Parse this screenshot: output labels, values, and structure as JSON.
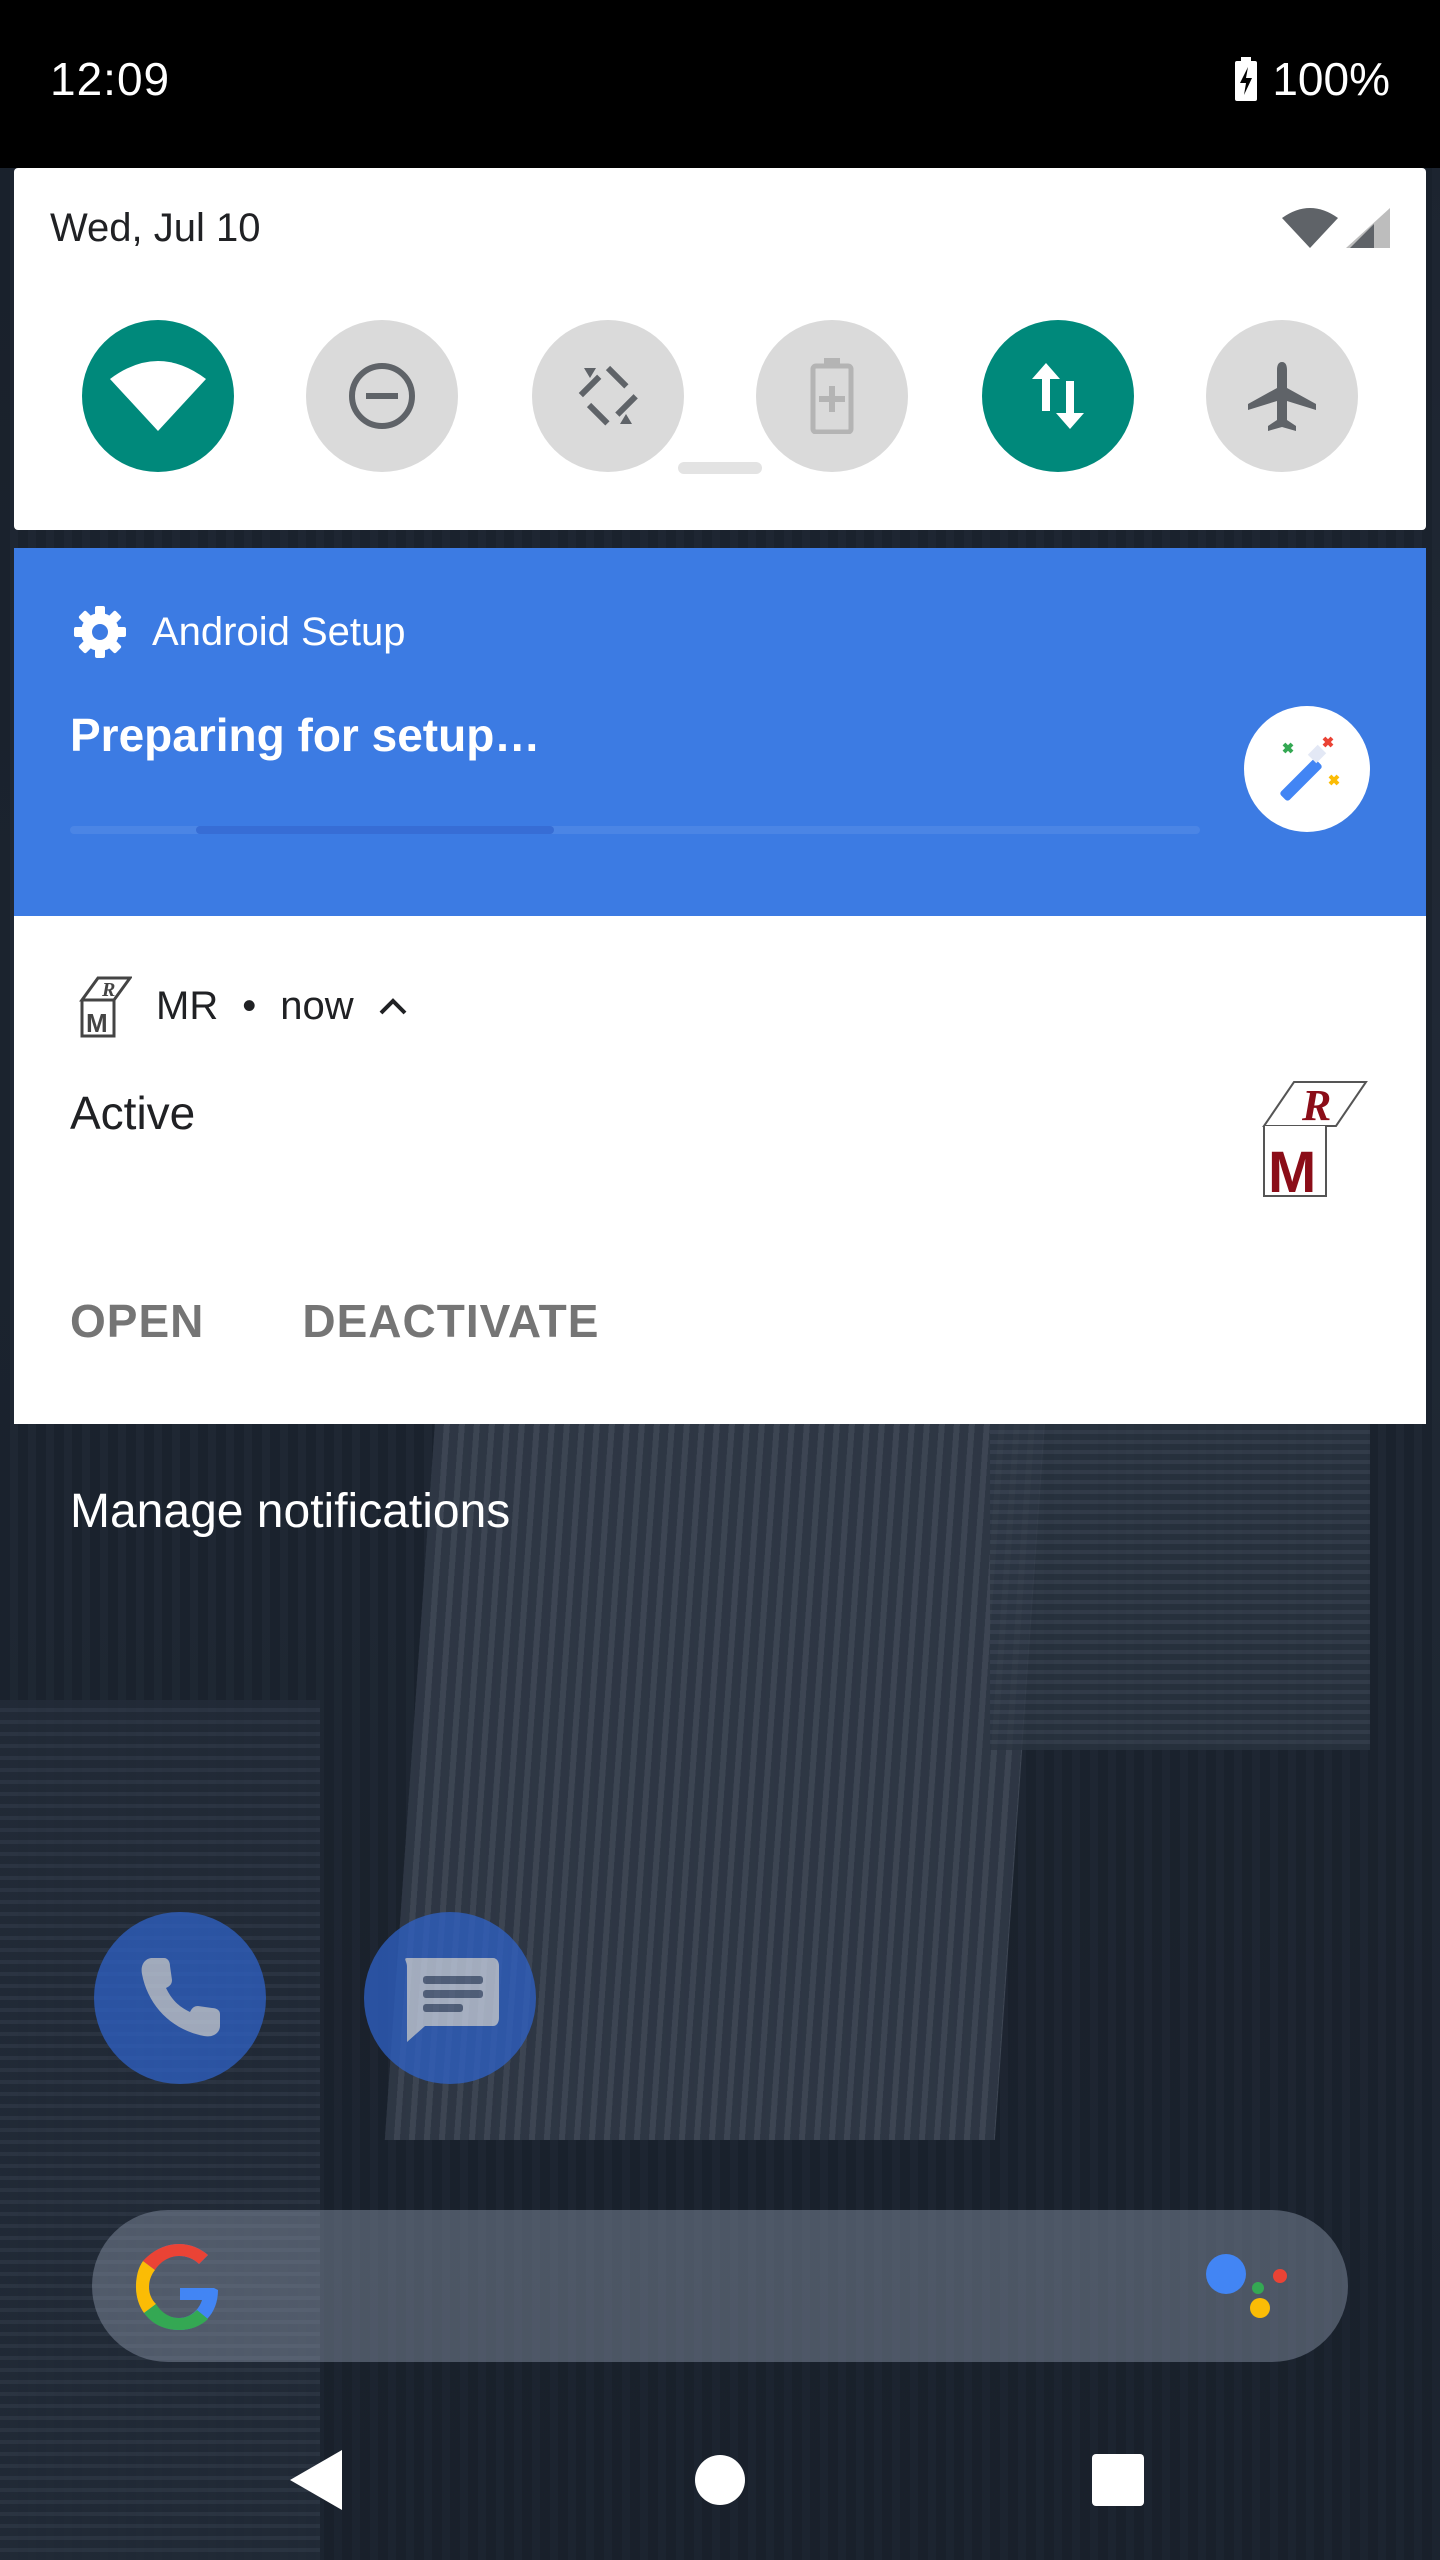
{
  "status_bar": {
    "time": "12:09",
    "battery": "100%"
  },
  "quick_settings": {
    "date": "Wed, Jul 10",
    "tiles": [
      {
        "name": "wifi",
        "state": "on"
      },
      {
        "name": "do-not-disturb",
        "state": "off"
      },
      {
        "name": "auto-rotate",
        "state": "off"
      },
      {
        "name": "battery-saver",
        "state": "off"
      },
      {
        "name": "mobile-data",
        "state": "on"
      },
      {
        "name": "airplane-mode",
        "state": "off"
      }
    ],
    "colors": {
      "tile_on": "#00897b",
      "tile_off": "#dadada"
    }
  },
  "notifications": [
    {
      "app": "Android Setup",
      "title": "Preparing for setup…",
      "background": "#3c7be3",
      "icon": "gear-icon",
      "large_icon": "magic-wand-icon"
    },
    {
      "app": "MR",
      "time": "now",
      "title": "Active",
      "actions": [
        "OPEN",
        "DEACTIVATE"
      ],
      "icon": "mr-logo-icon"
    }
  ],
  "manage_label": "Manage notifications",
  "home": {
    "dock": [
      "phone-icon",
      "messages-icon"
    ],
    "search": "google-search-bar"
  }
}
